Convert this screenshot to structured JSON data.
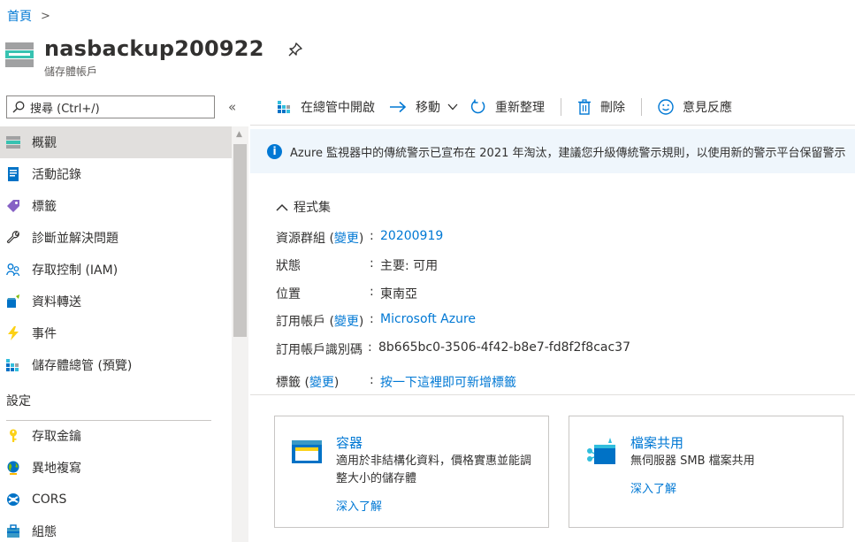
{
  "breadcrumb": {
    "home": "首頁",
    "separator": ">"
  },
  "header": {
    "title": "nasbackup200922",
    "subtitle": "儲存體帳戶",
    "resource_icon": "storage-account-icon",
    "pin_icon": "pin-icon"
  },
  "search": {
    "placeholder": "搜尋 (Ctrl+/)",
    "collapse": "«"
  },
  "nav": {
    "items": [
      {
        "label": "概觀",
        "icon": "overview-icon",
        "active": true
      },
      {
        "label": "活動記錄",
        "icon": "activity-log-icon"
      },
      {
        "label": "標籤",
        "icon": "tag-icon"
      },
      {
        "label": "診斷並解決問題",
        "icon": "wrench-icon"
      },
      {
        "label": "存取控制 (IAM)",
        "icon": "iam-icon"
      },
      {
        "label": "資料轉送",
        "icon": "data-transfer-icon"
      },
      {
        "label": "事件",
        "icon": "lightning-icon"
      },
      {
        "label": "儲存體總管 (預覽)",
        "icon": "storage-explorer-icon"
      }
    ],
    "section_settings": "設定",
    "settings_items": [
      {
        "label": "存取金鑰",
        "icon": "key-icon"
      },
      {
        "label": "異地複寫",
        "icon": "globe-icon"
      },
      {
        "label": "CORS",
        "icon": "cors-icon"
      },
      {
        "label": "組態",
        "icon": "configuration-icon"
      }
    ]
  },
  "toolbar": {
    "open_explorer": "在總管中開啟",
    "move": "移動",
    "refresh": "重新整理",
    "delete": "刪除",
    "feedback": "意見反應"
  },
  "banner": {
    "text": "Azure 監視器中的傳統警示已宣布在 2021 年淘汰，建議您升級傳統警示規則，以使用新的警示平台保留警示"
  },
  "essentials": {
    "toggle": "程式集",
    "change": "變更",
    "resource_group": {
      "label": "資源群組",
      "value": "20200919"
    },
    "status": {
      "label": "狀態",
      "value": "主要: 可用"
    },
    "location": {
      "label": "位置",
      "value": "東南亞"
    },
    "subscription": {
      "label": "訂用帳戶",
      "value": "Microsoft Azure"
    },
    "subscription_id": {
      "label": "訂用帳戶識別碼",
      "value": "8b665bc0-3506-4f42-b8e7-fd8f2f8cac37"
    },
    "tags": {
      "label": "標籤",
      "value": "按一下這裡即可新增標籤"
    }
  },
  "cards": [
    {
      "title": "容器",
      "description": "適用於非結構化資料，價格實惠並能調整大小的儲存體",
      "link": "深入了解",
      "icon": "container-icon"
    },
    {
      "title": "檔案共用",
      "description": "無伺服器 SMB 檔案共用",
      "link": "深入了解",
      "icon": "file-share-icon"
    }
  ],
  "colors": {
    "accent": "#0078d4",
    "banner_bg": "#eff6fc",
    "nav_active": "#e1dfdd"
  }
}
